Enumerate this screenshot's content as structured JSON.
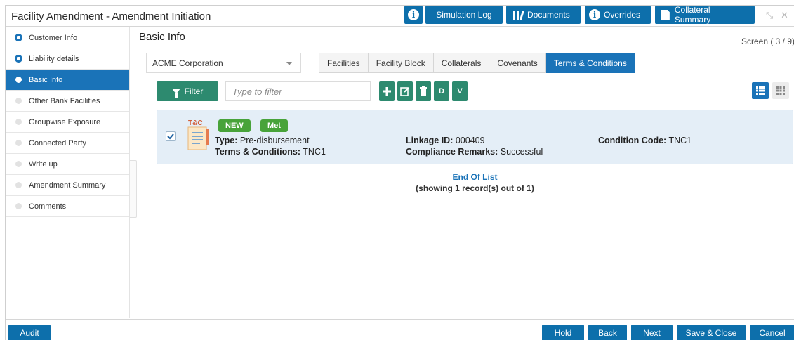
{
  "header": {
    "title": "Facility Amendment - Amendment Initiation",
    "buttons": {
      "simulation_log": "Simulation Log",
      "documents": "Documents",
      "overrides": "Overrides",
      "collateral_summary": "Collateral Summary"
    },
    "icons": [
      "info-icon",
      "library-icon",
      "info-icon",
      "document-icon",
      "minimize-icon",
      "close-icon"
    ]
  },
  "sidebar": {
    "items": [
      {
        "label": "Customer Info",
        "state": "locked"
      },
      {
        "label": "Liability details",
        "state": "locked"
      },
      {
        "label": "Basic Info",
        "state": "current"
      },
      {
        "label": "Other Bank Facilities",
        "state": "pending"
      },
      {
        "label": "Groupwise Exposure",
        "state": "pending"
      },
      {
        "label": "Connected Party",
        "state": "pending"
      },
      {
        "label": "Write up",
        "state": "pending"
      },
      {
        "label": "Amendment Summary",
        "state": "pending"
      },
      {
        "label": "Comments",
        "state": "pending"
      }
    ]
  },
  "main": {
    "section_title": "Basic Info",
    "screen_count": "Screen ( 3 / 9)",
    "party_select": "ACME Corporation",
    "tabs": [
      "Facilities",
      "Facility Block",
      "Collaterals",
      "Covenants",
      "Terms & Conditions"
    ],
    "active_tab": "Terms & Conditions",
    "filter_label": "Filter",
    "filter_placeholder": "Type to filter",
    "action_buttons": {
      "delete": "D",
      "view": "V"
    },
    "record": {
      "icon_label": "T&C",
      "badges": [
        "NEW",
        "Met"
      ],
      "type_label": "Type:",
      "type_value": "Pre-disbursement",
      "terms_label": "Terms & Conditions:",
      "terms_value": "TNC1",
      "linkage_label": "Linkage ID:",
      "linkage_value": "000409",
      "compliance_label": "Compliance Remarks:",
      "compliance_value": "Successful",
      "condition_label": "Condition Code:",
      "condition_value": "TNC1",
      "checked": true
    },
    "end_of_list": "End Of List",
    "record_count": "(showing 1 record(s) out of 1)"
  },
  "footer": {
    "audit": "Audit",
    "hold": "Hold",
    "back": "Back",
    "next": "Next",
    "save_close": "Save & Close",
    "cancel": "Cancel"
  },
  "colors": {
    "primary": "#0d6fab",
    "accent_green": "#2d8a6f",
    "badge_green": "#48a33a",
    "card_bg": "#e4eef7"
  }
}
